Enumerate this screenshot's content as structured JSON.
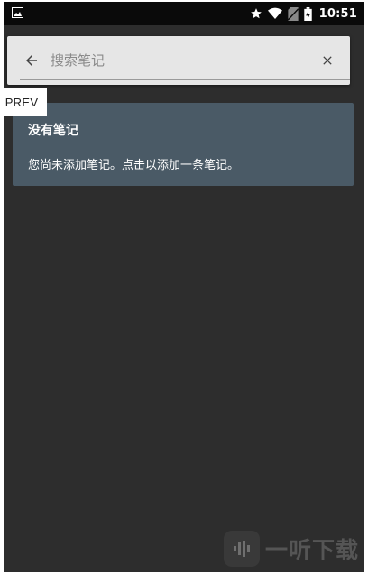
{
  "status_bar": {
    "time": "10:51",
    "left_icon": "image-icon",
    "right_icons": [
      "star-icon",
      "wifi-icon",
      "no-sim-icon",
      "battery-charging-icon"
    ]
  },
  "search": {
    "placeholder": "搜索笔记",
    "value": "",
    "back_icon": "arrow-left-icon",
    "clear_icon": "close-icon"
  },
  "prev_label": "PREV",
  "empty_state": {
    "title": "没有笔记",
    "message": "您尚未添加笔记。点击以添加一条笔记。"
  },
  "watermark": {
    "text": "一听下载"
  },
  "colors": {
    "background": "#2d2d2d",
    "status_bar": "#0a0a0a",
    "search_card": "#e6e6e6",
    "empty_card": "#4a5a66"
  }
}
